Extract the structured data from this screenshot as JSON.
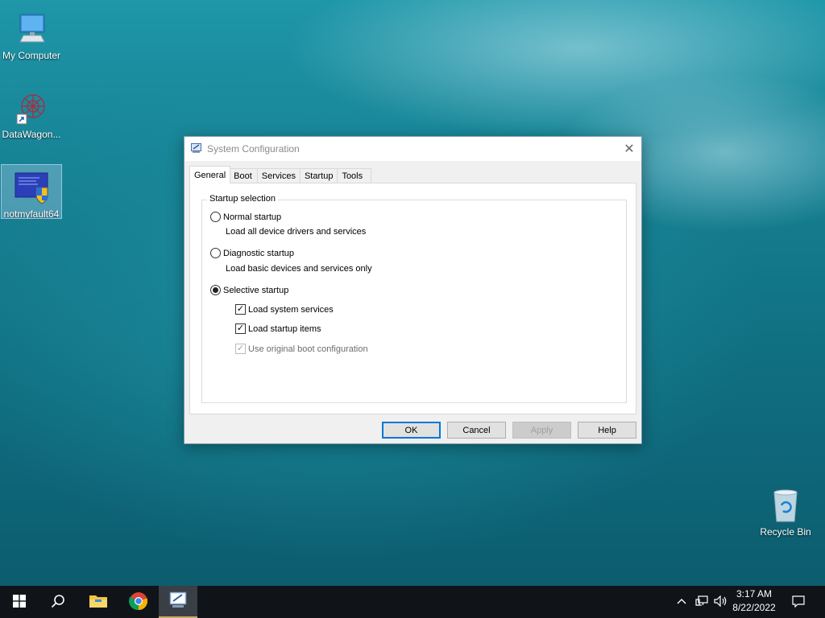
{
  "desktop": {
    "icons": [
      {
        "label": "My Computer"
      },
      {
        "label": "DataWagon..."
      },
      {
        "label": "notmyfault64"
      },
      {
        "label": "Recycle Bin"
      }
    ]
  },
  "dialog": {
    "title": "System Configuration",
    "tabs": [
      {
        "label": "General",
        "active": true
      },
      {
        "label": "Boot"
      },
      {
        "label": "Services"
      },
      {
        "label": "Startup"
      },
      {
        "label": "Tools"
      }
    ],
    "group_title": "Startup selection",
    "options": {
      "normal": {
        "label": "Normal startup",
        "desc": "Load all device drivers and services",
        "selected": false
      },
      "diagnostic": {
        "label": "Diagnostic startup",
        "desc": "Load basic devices and services only",
        "selected": false
      },
      "selective": {
        "label": "Selective startup",
        "selected": true
      }
    },
    "checkboxes": {
      "load_system_services": {
        "label": "Load system services",
        "checked": true
      },
      "load_startup_items": {
        "label": "Load startup items",
        "checked": true
      },
      "use_original_boot": {
        "label": "Use original boot configuration",
        "checked": true,
        "disabled": true
      }
    },
    "buttons": {
      "ok": "OK",
      "cancel": "Cancel",
      "apply": "Apply",
      "help": "Help"
    },
    "close_glyph": "✕"
  },
  "taskbar": {
    "items": [
      "start-icon",
      "search-icon",
      "file-explorer-icon",
      "chrome-icon",
      "system-configuration-icon"
    ],
    "time": "3:17 AM",
    "date": "8/22/2022",
    "tray": [
      "chevron-up-icon",
      "network-icon",
      "volume-icon",
      "notification-icon"
    ]
  },
  "colors": {
    "accent": "#0078d7",
    "taskbar": "#101418",
    "active_task_underline": "#c9a96e"
  }
}
